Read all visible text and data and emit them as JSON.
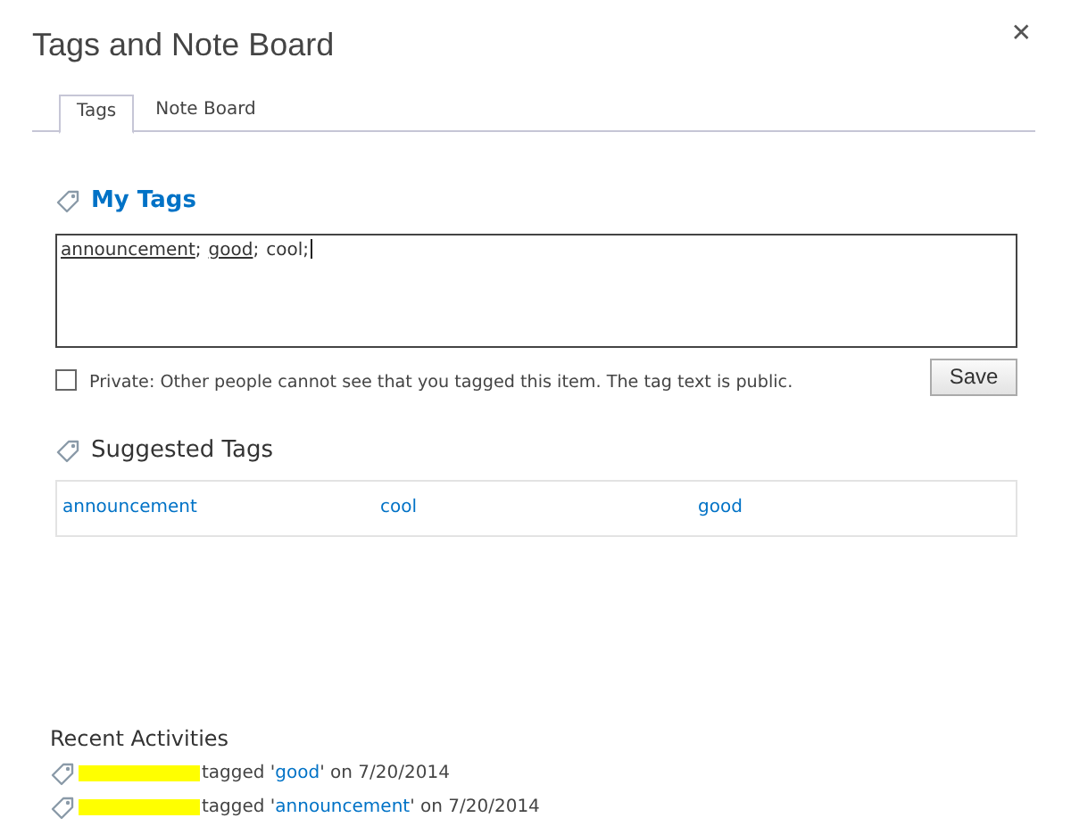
{
  "window": {
    "title": "Tags and Note Board",
    "close": "✕"
  },
  "tabs": [
    {
      "label": "Tags",
      "selected": true
    },
    {
      "label": "Note Board",
      "selected": false
    }
  ],
  "my_tags": {
    "heading": "My Tags",
    "tags": [
      {
        "text": "announcement",
        "underlined": true,
        "separator": ";"
      },
      {
        "text": "good",
        "underlined": true,
        "separator": ";"
      },
      {
        "text": "cool",
        "underlined": false,
        "separator": ";"
      }
    ]
  },
  "private": {
    "checked": false,
    "label": "Private: Other people cannot see that you tagged this item. The tag text is public."
  },
  "save_button": "Save",
  "suggested_tags": {
    "heading": "Suggested Tags",
    "tags": [
      "announcement",
      "cool",
      "good"
    ]
  },
  "recent_activities": {
    "heading": "Recent Activities",
    "items": [
      {
        "before": "tagged '",
        "tag": "good",
        "after": "' on 7/20/2014"
      },
      {
        "before": "tagged '",
        "tag": "announcement",
        "after": "' on 7/20/2014"
      }
    ]
  }
}
